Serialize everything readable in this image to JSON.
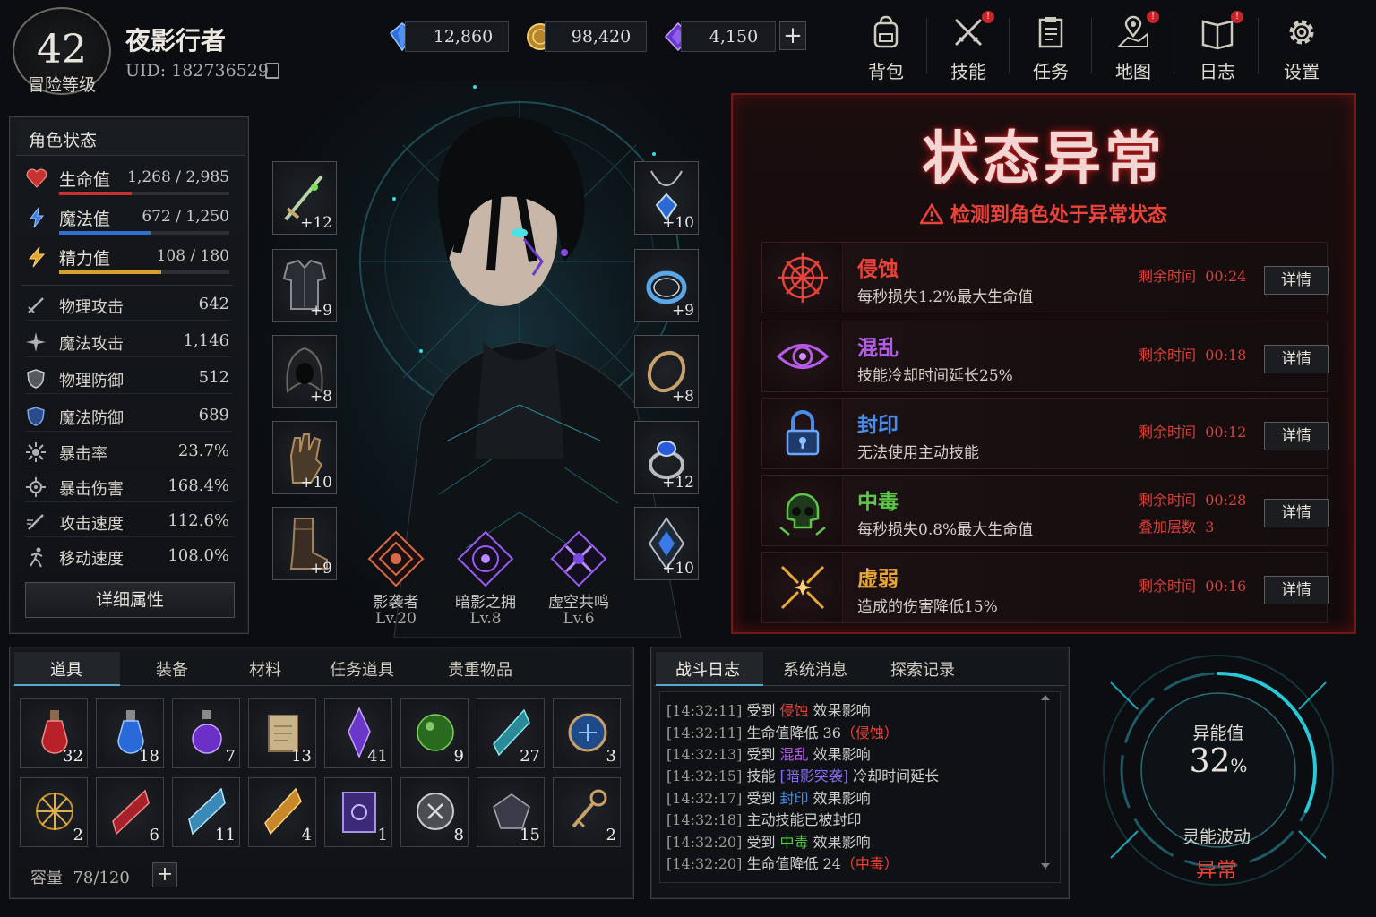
{
  "player": {
    "level": "42",
    "level_label": "冒险等级",
    "name": "夜影行者",
    "uid": "UID: 182736529"
  },
  "currency": [
    {
      "name": "blue-crystal",
      "value": "12,860",
      "color": "#4a8cf0"
    },
    {
      "name": "gold-coin",
      "value": "98,420",
      "color": "#d8a83a"
    },
    {
      "name": "purple-gem",
      "value": "4,150",
      "color": "#9a5cf0"
    }
  ],
  "currency_plus": "+",
  "nav": [
    {
      "label": "背包",
      "icon": "backpack-icon",
      "badge": false
    },
    {
      "label": "技能",
      "icon": "crossed-swords-icon",
      "badge": true
    },
    {
      "label": "任务",
      "icon": "clipboard-icon",
      "badge": false
    },
    {
      "label": "地图",
      "icon": "map-pin-icon",
      "badge": true
    },
    {
      "label": "日志",
      "icon": "book-icon",
      "badge": true
    },
    {
      "label": "设置",
      "icon": "gear-icon",
      "badge": false
    }
  ],
  "nav_badge": "!",
  "stats": {
    "title": "角色状态",
    "bars": [
      {
        "label": "生命值",
        "value": "1,268 / 2,985",
        "fill": 0.425,
        "color": "#c8332f"
      },
      {
        "label": "魔法值",
        "value": "672 / 1,250",
        "fill": 0.538,
        "color": "#2f6fcf"
      },
      {
        "label": "精力值",
        "value": "108 / 180",
        "fill": 0.6,
        "color": "#d8a02a"
      }
    ],
    "rows": [
      {
        "label": "物理攻击",
        "value": "642"
      },
      {
        "label": "魔法攻击",
        "value": "1,146"
      },
      {
        "label": "物理防御",
        "value": "512"
      },
      {
        "label": "魔法防御",
        "value": "689"
      },
      {
        "label": "暴击率",
        "value": "23.7%"
      },
      {
        "label": "暴击伤害",
        "value": "168.4%"
      },
      {
        "label": "攻击速度",
        "value": "112.6%"
      },
      {
        "label": "移动速度",
        "value": "108.0%"
      }
    ],
    "detail_button": "详细属性"
  },
  "equipment": {
    "left": [
      {
        "name": "dagger",
        "plus": "+12"
      },
      {
        "name": "armor",
        "plus": "+9"
      },
      {
        "name": "hood",
        "plus": "+8"
      },
      {
        "name": "gloves",
        "plus": "+10"
      },
      {
        "name": "boots",
        "plus": "+9"
      }
    ],
    "right": [
      {
        "name": "amulet",
        "plus": "+10"
      },
      {
        "name": "ring",
        "plus": "+9"
      },
      {
        "name": "bracelet",
        "plus": "+8"
      },
      {
        "name": "sapphire-ring",
        "plus": "+12"
      },
      {
        "name": "charm",
        "plus": "+10"
      }
    ]
  },
  "skills": [
    {
      "name": "影袭者",
      "level": "Lv.20",
      "color": "#d86a4a"
    },
    {
      "name": "暗影之拥",
      "level": "Lv.8",
      "color": "#9a5cf0"
    },
    {
      "name": "虚空共鸣",
      "level": "Lv.6",
      "color": "#9a5cf0"
    }
  ],
  "abnormal": {
    "title": "状态异常",
    "warning": "检测到角色处于异常状态",
    "effects": [
      {
        "name": "侵蚀",
        "desc": "每秒损失1.2%最大生命值",
        "time_label": "剩余时间",
        "time": "00:24",
        "color": "#e8433a",
        "icon": "crosshair-icon",
        "button": "详情"
      },
      {
        "name": "混乱",
        "desc": "技能冷却时间延长25%",
        "time_label": "剩余时间",
        "time": "00:18",
        "color": "#b45ce8",
        "icon": "eye-icon",
        "button": "详情"
      },
      {
        "name": "封印",
        "desc": "无法使用主动技能",
        "time_label": "剩余时间",
        "time": "00:12",
        "color": "#4a8ce8",
        "icon": "lock-icon",
        "button": "详情"
      },
      {
        "name": "中毒",
        "desc": "每秒损失0.8%最大生命值",
        "time_label": "剩余时间",
        "time": "00:28",
        "stack_label": "叠加层数",
        "stack": "3",
        "color": "#5cc84a",
        "icon": "skull-icon",
        "button": "详情"
      },
      {
        "name": "虚弱",
        "desc": "造成的伤害降低15%",
        "time_label": "剩余时间",
        "time": "00:16",
        "color": "#e8a83a",
        "icon": "broken-swords-icon",
        "button": "详情"
      }
    ]
  },
  "inventory": {
    "tabs": [
      "道具",
      "装备",
      "材料",
      "任务道具",
      "贵重物品"
    ],
    "active_tab": "道具",
    "items": [
      {
        "icon": "red-potion",
        "count": "32"
      },
      {
        "icon": "blue-potion",
        "count": "18"
      },
      {
        "icon": "purple-potion",
        "count": "7"
      },
      {
        "icon": "scroll",
        "count": "13"
      },
      {
        "icon": "violet-crystal",
        "count": "41"
      },
      {
        "icon": "green-orb",
        "count": "9"
      },
      {
        "icon": "cyan-shard",
        "count": "27"
      },
      {
        "icon": "blue-medallion",
        "count": "3"
      },
      {
        "icon": "gold-rune",
        "count": "2"
      },
      {
        "icon": "red-crystal",
        "count": "6"
      },
      {
        "icon": "ice-crystal",
        "count": "11"
      },
      {
        "icon": "amber-crystal",
        "count": "4"
      },
      {
        "icon": "spell-book",
        "count": "1"
      },
      {
        "icon": "silver-coin",
        "count": "8"
      },
      {
        "icon": "dark-gem",
        "count": "15"
      },
      {
        "icon": "gold-key",
        "count": "2"
      }
    ],
    "capacity_label": "容量",
    "capacity": "78/120",
    "add": "+"
  },
  "log": {
    "tabs": [
      "战斗日志",
      "系统消息",
      "探索记录"
    ],
    "active_tab": "战斗日志",
    "lines": [
      {
        "time": "[14:32:11]",
        "pre": "受到",
        "tag": "侵蚀",
        "post": "效果影响",
        "tag_color": "#e8433a"
      },
      {
        "time": "[14:32:11]",
        "pre": "生命值降低 36",
        "tag": "（侵蚀）",
        "post": "",
        "tag_color": "#e8433a"
      },
      {
        "time": "[14:32:13]",
        "pre": "受到",
        "tag": "混乱",
        "post": "效果影响",
        "tag_color": "#b45ce8"
      },
      {
        "time": "[14:32:15]",
        "pre": "技能",
        "tag": "[暗影突袭]",
        "post": "冷却时间延长",
        "tag_color": "#8a6cf0"
      },
      {
        "time": "[14:32:17]",
        "pre": "受到",
        "tag": "封印",
        "post": "效果影响",
        "tag_color": "#4a8ce8"
      },
      {
        "time": "[14:32:18]",
        "pre": "主动技能已被封印",
        "tag": "",
        "post": "",
        "tag_color": "#cfcfcf"
      },
      {
        "time": "[14:32:20]",
        "pre": "受到",
        "tag": "中毒",
        "post": "效果影响",
        "tag_color": "#5cc84a"
      },
      {
        "time": "[14:32:20]",
        "pre": "生命值降低 24",
        "tag": "（中毒）",
        "post": "",
        "tag_color": "#e8433a"
      }
    ]
  },
  "psionic": {
    "label": "异能值",
    "value": "32",
    "unit": "%",
    "wave_label": "灵能波动",
    "wave_status": "异常",
    "accent": "#28c8d8",
    "alert": "#e8433a"
  }
}
